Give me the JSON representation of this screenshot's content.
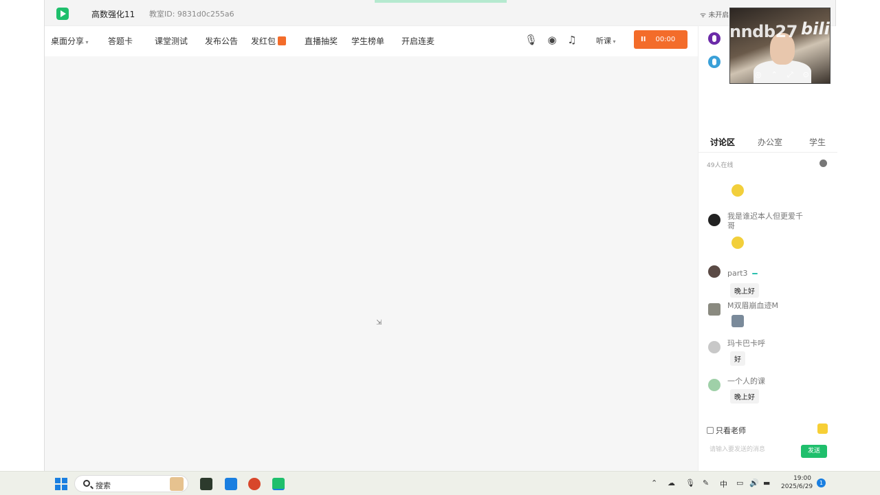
{
  "window": {
    "course_title": "高数强化11",
    "room_id": "教室ID: 9831d0c255a6",
    "network_status": "未开启"
  },
  "toolbar": {
    "items": [
      "桌面分享",
      "答题卡",
      "课堂测试",
      "发布公告",
      "发红包",
      "直播抽奖",
      "学生榜单",
      "开启连麦"
    ],
    "listen_label": "听课",
    "record_time": "00:00",
    "icons": [
      "microphone-icon",
      "camera-icon",
      "music-icon"
    ]
  },
  "sidebar": {
    "tabs": [
      "讨论区",
      "办公室",
      "学生"
    ],
    "online_count": "49人在线",
    "only_teacher_label": "只看老师",
    "input_placeholder": "请输入要发送的消息",
    "send_label": "发送",
    "messages": [
      {
        "user": "我是谁迟本人但更爱千哥",
        "content_type": "emoji",
        "text": ""
      },
      {
        "user": "part3",
        "badge": "",
        "content_type": "text",
        "text": "晚上好"
      },
      {
        "user": "M双眉崩血迹M",
        "content_type": "emoji",
        "text": ""
      },
      {
        "user": "玛卡巴卡呼",
        "content_type": "text",
        "text": "好"
      },
      {
        "user": "一个人的课",
        "content_type": "text",
        "text": "晚上好"
      }
    ]
  },
  "overlay": {
    "watermark": "nndb27",
    "bilibili": "bilibili"
  },
  "taskbar": {
    "search_label": "搜索",
    "ime": "中",
    "time": "19:00",
    "date": "2025/6/29",
    "notification_count": "1"
  },
  "colors": {
    "accent_green": "#1fbf6c",
    "record_orange": "#f36c2a",
    "windows_blue": "#1a7fe0"
  }
}
